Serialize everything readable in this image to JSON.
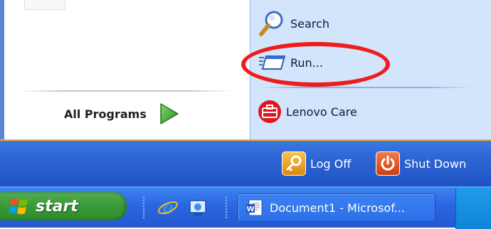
{
  "start_menu": {
    "all_programs_label": "All Programs",
    "places": {
      "search_label": "Search",
      "run_label": "Run...",
      "lenovo_label": "Lenovo Care"
    },
    "bottom_bar": {
      "logoff_label": "Log Off",
      "shutdown_label": "Shut Down"
    }
  },
  "taskbar": {
    "start_label": "start",
    "tasks": [
      {
        "label": "Document1 - Microsof..."
      }
    ]
  },
  "icons": {
    "search": "magnifier-icon",
    "run": "run-window-icon",
    "lenovo": "toolbox-icon",
    "all_programs": "green-arrow-icon",
    "logoff": "key-icon",
    "shutdown": "power-icon",
    "start": "windows-flag-icon",
    "ie": "internet-explorer-icon",
    "desktop": "show-desktop-icon",
    "document": "word-document-icon"
  },
  "colors": {
    "highlight": "#ee1c1c",
    "start_green": "#3a9a37",
    "taskbar_blue": "#2a66e0",
    "right_pane": "#d3e5fa"
  }
}
